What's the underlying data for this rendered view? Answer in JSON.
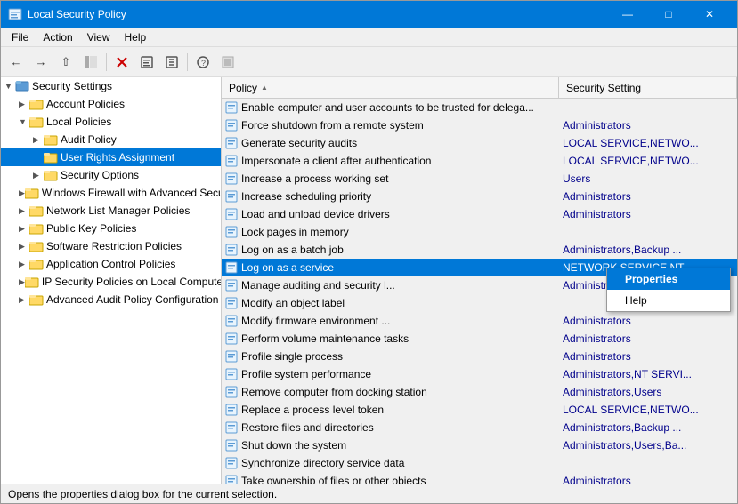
{
  "window": {
    "title": "Local Security Policy",
    "minimize": "—",
    "maximize": "□",
    "close": "✕"
  },
  "menu": {
    "items": [
      "File",
      "Action",
      "View",
      "Help"
    ]
  },
  "toolbar": {
    "buttons": [
      "←",
      "→",
      "⬆",
      "▦",
      "✕",
      "▤",
      "▥",
      "⊟",
      "?",
      "▣"
    ]
  },
  "tree": {
    "items": [
      {
        "id": "security-settings",
        "label": "Security Settings",
        "indent": 1,
        "expanded": true,
        "type": "root"
      },
      {
        "id": "account-policies",
        "label": "Account Policies",
        "indent": 2,
        "expanded": false,
        "type": "folder"
      },
      {
        "id": "local-policies",
        "label": "Local Policies",
        "indent": 2,
        "expanded": true,
        "type": "folder"
      },
      {
        "id": "audit-policy",
        "label": "Audit Policy",
        "indent": 3,
        "expanded": false,
        "type": "folder"
      },
      {
        "id": "user-rights-assignment",
        "label": "User Rights Assignment",
        "indent": 3,
        "expanded": false,
        "type": "folder",
        "selected": true
      },
      {
        "id": "security-options",
        "label": "Security Options",
        "indent": 3,
        "expanded": false,
        "type": "folder"
      },
      {
        "id": "windows-firewall",
        "label": "Windows Firewall with Advanced Secu...",
        "indent": 2,
        "expanded": false,
        "type": "folder"
      },
      {
        "id": "network-list",
        "label": "Network List Manager Policies",
        "indent": 2,
        "expanded": false,
        "type": "folder"
      },
      {
        "id": "public-key",
        "label": "Public Key Policies",
        "indent": 2,
        "expanded": false,
        "type": "folder"
      },
      {
        "id": "software-restriction",
        "label": "Software Restriction Policies",
        "indent": 2,
        "expanded": false,
        "type": "folder"
      },
      {
        "id": "app-control",
        "label": "Application Control Policies",
        "indent": 2,
        "expanded": false,
        "type": "folder"
      },
      {
        "id": "ip-security",
        "label": "IP Security Policies on Local Compute...",
        "indent": 2,
        "expanded": false,
        "type": "folder"
      },
      {
        "id": "advanced-audit",
        "label": "Advanced Audit Policy Configuration",
        "indent": 2,
        "expanded": false,
        "type": "folder"
      }
    ]
  },
  "list": {
    "col_policy": "Policy",
    "col_security": "Security Setting",
    "sort_arrow": "▲",
    "rows": [
      {
        "policy": "Enable computer and user accounts to be trusted for delega...",
        "security": "",
        "selected": false
      },
      {
        "policy": "Force shutdown from a remote system",
        "security": "Administrators",
        "selected": false
      },
      {
        "policy": "Generate security audits",
        "security": "LOCAL SERVICE,NETWO...",
        "selected": false
      },
      {
        "policy": "Impersonate a client after authentication",
        "security": "LOCAL SERVICE,NETWO...",
        "selected": false
      },
      {
        "policy": "Increase a process working set",
        "security": "Users",
        "selected": false
      },
      {
        "policy": "Increase scheduling priority",
        "security": "Administrators",
        "selected": false
      },
      {
        "policy": "Load and unload device drivers",
        "security": "Administrators",
        "selected": false
      },
      {
        "policy": "Lock pages in memory",
        "security": "",
        "selected": false
      },
      {
        "policy": "Log on as a batch job",
        "security": "Administrators,Backup ...",
        "selected": false
      },
      {
        "policy": "Log on as a service",
        "security": "NETWORK SERVICE,NT ...",
        "selected": true
      },
      {
        "policy": "Manage auditing and security l...",
        "security": "Administrators",
        "selected": false
      },
      {
        "policy": "Modify an object label",
        "security": "",
        "selected": false
      },
      {
        "policy": "Modify firmware environment ...",
        "security": "Administrators",
        "selected": false
      },
      {
        "policy": "Perform volume maintenance tasks",
        "security": "Administrators",
        "selected": false
      },
      {
        "policy": "Profile single process",
        "security": "Administrators",
        "selected": false
      },
      {
        "policy": "Profile system performance",
        "security": "Administrators,NT SERVI...",
        "selected": false
      },
      {
        "policy": "Remove computer from docking station",
        "security": "Administrators,Users",
        "selected": false
      },
      {
        "policy": "Replace a process level token",
        "security": "LOCAL SERVICE,NETWO...",
        "selected": false
      },
      {
        "policy": "Restore files and directories",
        "security": "Administrators,Backup ...",
        "selected": false
      },
      {
        "policy": "Shut down the system",
        "security": "Administrators,Users,Ba...",
        "selected": false
      },
      {
        "policy": "Synchronize directory service data",
        "security": "",
        "selected": false
      },
      {
        "policy": "Take ownership of files or other objects",
        "security": "Administrators",
        "selected": false
      }
    ]
  },
  "context_menu": {
    "items": [
      {
        "label": "Properties",
        "active": true
      },
      {
        "label": "Help",
        "active": false
      }
    ]
  },
  "status_bar": {
    "text": "Opens the properties dialog box for the current selection."
  },
  "colors": {
    "selected_bg": "#0078d7",
    "security_text": "#00008b",
    "hover_bg": "#cce8ff"
  }
}
